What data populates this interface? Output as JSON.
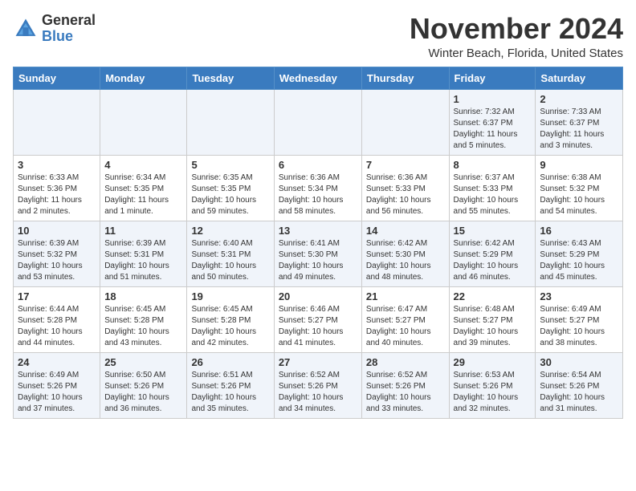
{
  "header": {
    "logo_general": "General",
    "logo_blue": "Blue",
    "month": "November 2024",
    "location": "Winter Beach, Florida, United States"
  },
  "days_of_week": [
    "Sunday",
    "Monday",
    "Tuesday",
    "Wednesday",
    "Thursday",
    "Friday",
    "Saturday"
  ],
  "weeks": [
    [
      {
        "day": "",
        "info": ""
      },
      {
        "day": "",
        "info": ""
      },
      {
        "day": "",
        "info": ""
      },
      {
        "day": "",
        "info": ""
      },
      {
        "day": "",
        "info": ""
      },
      {
        "day": "1",
        "info": "Sunrise: 7:32 AM\nSunset: 6:37 PM\nDaylight: 11 hours\nand 5 minutes."
      },
      {
        "day": "2",
        "info": "Sunrise: 7:33 AM\nSunset: 6:37 PM\nDaylight: 11 hours\nand 3 minutes."
      }
    ],
    [
      {
        "day": "3",
        "info": "Sunrise: 6:33 AM\nSunset: 5:36 PM\nDaylight: 11 hours\nand 2 minutes."
      },
      {
        "day": "4",
        "info": "Sunrise: 6:34 AM\nSunset: 5:35 PM\nDaylight: 11 hours\nand 1 minute."
      },
      {
        "day": "5",
        "info": "Sunrise: 6:35 AM\nSunset: 5:35 PM\nDaylight: 10 hours\nand 59 minutes."
      },
      {
        "day": "6",
        "info": "Sunrise: 6:36 AM\nSunset: 5:34 PM\nDaylight: 10 hours\nand 58 minutes."
      },
      {
        "day": "7",
        "info": "Sunrise: 6:36 AM\nSunset: 5:33 PM\nDaylight: 10 hours\nand 56 minutes."
      },
      {
        "day": "8",
        "info": "Sunrise: 6:37 AM\nSunset: 5:33 PM\nDaylight: 10 hours\nand 55 minutes."
      },
      {
        "day": "9",
        "info": "Sunrise: 6:38 AM\nSunset: 5:32 PM\nDaylight: 10 hours\nand 54 minutes."
      }
    ],
    [
      {
        "day": "10",
        "info": "Sunrise: 6:39 AM\nSunset: 5:32 PM\nDaylight: 10 hours\nand 53 minutes."
      },
      {
        "day": "11",
        "info": "Sunrise: 6:39 AM\nSunset: 5:31 PM\nDaylight: 10 hours\nand 51 minutes."
      },
      {
        "day": "12",
        "info": "Sunrise: 6:40 AM\nSunset: 5:31 PM\nDaylight: 10 hours\nand 50 minutes."
      },
      {
        "day": "13",
        "info": "Sunrise: 6:41 AM\nSunset: 5:30 PM\nDaylight: 10 hours\nand 49 minutes."
      },
      {
        "day": "14",
        "info": "Sunrise: 6:42 AM\nSunset: 5:30 PM\nDaylight: 10 hours\nand 48 minutes."
      },
      {
        "day": "15",
        "info": "Sunrise: 6:42 AM\nSunset: 5:29 PM\nDaylight: 10 hours\nand 46 minutes."
      },
      {
        "day": "16",
        "info": "Sunrise: 6:43 AM\nSunset: 5:29 PM\nDaylight: 10 hours\nand 45 minutes."
      }
    ],
    [
      {
        "day": "17",
        "info": "Sunrise: 6:44 AM\nSunset: 5:28 PM\nDaylight: 10 hours\nand 44 minutes."
      },
      {
        "day": "18",
        "info": "Sunrise: 6:45 AM\nSunset: 5:28 PM\nDaylight: 10 hours\nand 43 minutes."
      },
      {
        "day": "19",
        "info": "Sunrise: 6:45 AM\nSunset: 5:28 PM\nDaylight: 10 hours\nand 42 minutes."
      },
      {
        "day": "20",
        "info": "Sunrise: 6:46 AM\nSunset: 5:27 PM\nDaylight: 10 hours\nand 41 minutes."
      },
      {
        "day": "21",
        "info": "Sunrise: 6:47 AM\nSunset: 5:27 PM\nDaylight: 10 hours\nand 40 minutes."
      },
      {
        "day": "22",
        "info": "Sunrise: 6:48 AM\nSunset: 5:27 PM\nDaylight: 10 hours\nand 39 minutes."
      },
      {
        "day": "23",
        "info": "Sunrise: 6:49 AM\nSunset: 5:27 PM\nDaylight: 10 hours\nand 38 minutes."
      }
    ],
    [
      {
        "day": "24",
        "info": "Sunrise: 6:49 AM\nSunset: 5:26 PM\nDaylight: 10 hours\nand 37 minutes."
      },
      {
        "day": "25",
        "info": "Sunrise: 6:50 AM\nSunset: 5:26 PM\nDaylight: 10 hours\nand 36 minutes."
      },
      {
        "day": "26",
        "info": "Sunrise: 6:51 AM\nSunset: 5:26 PM\nDaylight: 10 hours\nand 35 minutes."
      },
      {
        "day": "27",
        "info": "Sunrise: 6:52 AM\nSunset: 5:26 PM\nDaylight: 10 hours\nand 34 minutes."
      },
      {
        "day": "28",
        "info": "Sunrise: 6:52 AM\nSunset: 5:26 PM\nDaylight: 10 hours\nand 33 minutes."
      },
      {
        "day": "29",
        "info": "Sunrise: 6:53 AM\nSunset: 5:26 PM\nDaylight: 10 hours\nand 32 minutes."
      },
      {
        "day": "30",
        "info": "Sunrise: 6:54 AM\nSunset: 5:26 PM\nDaylight: 10 hours\nand 31 minutes."
      }
    ]
  ]
}
